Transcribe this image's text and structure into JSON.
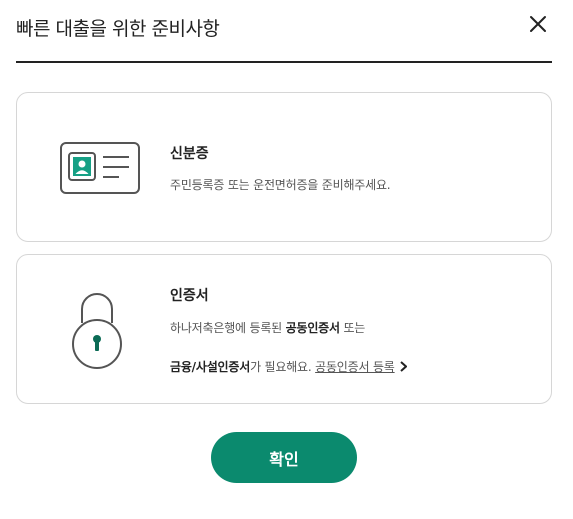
{
  "dialog": {
    "title": "빠른 대출을 위한 준비사항",
    "close_icon": "close-icon"
  },
  "cards": {
    "id_card": {
      "icon": "id-card-icon",
      "title": "신분증",
      "description": "주민등록증 또는 운전면허증을 준비해주세요."
    },
    "certificate": {
      "icon": "lock-icon",
      "title": "인증서",
      "line1_prefix": "하나저축은행에 등록된 ",
      "line1_bold": "공동인증서",
      "line1_suffix": " 또는",
      "line2_bold": "금융/사설인증서",
      "line2_text": "가 필요해요. ",
      "link_label": "공동인증서 등록",
      "link_icon": "chevron-right-icon"
    }
  },
  "confirm_button": {
    "label": "확인"
  },
  "colors": {
    "accent": "#0b8a6e",
    "icon_stroke": "#555555"
  }
}
